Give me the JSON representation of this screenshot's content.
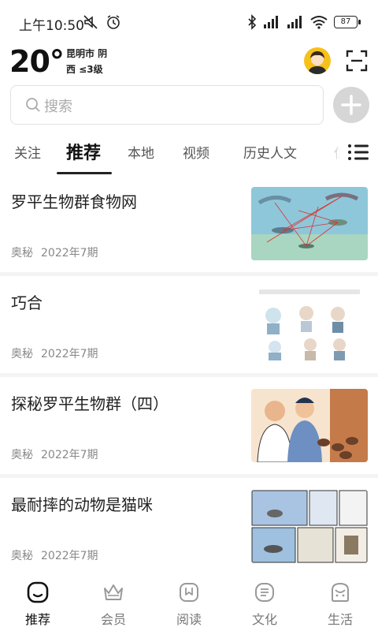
{
  "status_bar": {
    "time": "上午10:50",
    "battery": "87"
  },
  "weather": {
    "temperature": "20°",
    "city_condition": "昆明市 阴",
    "wind": "西 ≤3级"
  },
  "search": {
    "placeholder": "搜索"
  },
  "tabs": [
    {
      "label": "关注"
    },
    {
      "label": "推荐"
    },
    {
      "label": "本地"
    },
    {
      "label": "视频"
    },
    {
      "label": "历史人文"
    },
    {
      "label": "信"
    }
  ],
  "feed": [
    {
      "title": "罗平生物群食物网",
      "source": "奥秘",
      "issue": "2022年7期"
    },
    {
      "title": "巧合",
      "source": "奥秘",
      "issue": "2022年7期"
    },
    {
      "title": "探秘罗平生物群（四）",
      "source": "奥秘",
      "issue": "2022年7期"
    },
    {
      "title": "最耐摔的动物是猫咪",
      "source": "奥秘",
      "issue": "2022年7期"
    }
  ],
  "bottom_nav": [
    {
      "label": "推荐",
      "icon": "recommend-icon"
    },
    {
      "label": "会员",
      "icon": "crown-icon"
    },
    {
      "label": "阅读",
      "icon": "book-icon"
    },
    {
      "label": "文化",
      "icon": "culture-icon"
    },
    {
      "label": "生活",
      "icon": "life-icon"
    }
  ],
  "colors": {
    "avatar_bg": "#f6c21a",
    "add_button_bg": "#d6d6d6",
    "active_text": "#111111",
    "inactive_text": "#777777"
  }
}
